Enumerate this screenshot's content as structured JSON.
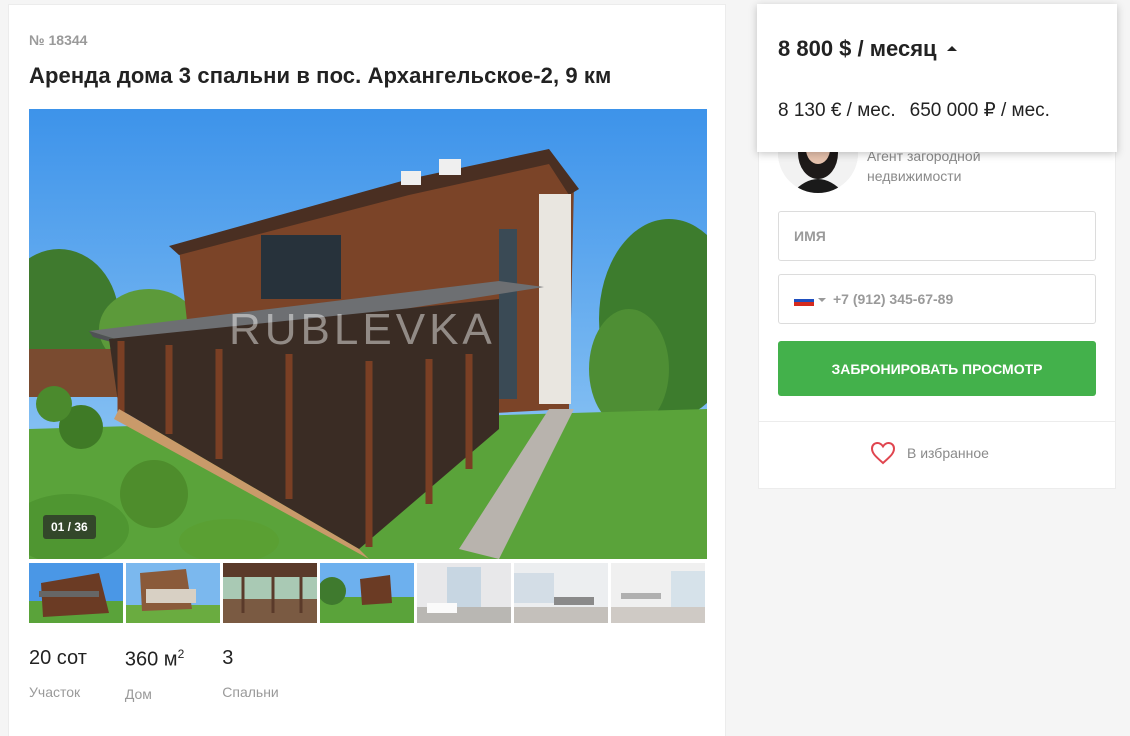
{
  "listing": {
    "number": "№ 18344",
    "title": "Аренда дома 3 спальни в пос. Архангельское-2, 9 км",
    "photo_counter": "01 / 36",
    "watermark": "RUBLEVKA"
  },
  "stats": [
    {
      "value": "20 сот",
      "label": "Участок"
    },
    {
      "value": "360 м",
      "sup": "2",
      "label": "Дом"
    },
    {
      "value": "3",
      "label": "Спальни"
    }
  ],
  "price": {
    "main": "8 800 $ / месяц",
    "eur": "8 130 € / мес.",
    "rub": "650 000 ₽ / мес."
  },
  "agent": {
    "role": "Агент загородной недвижимости"
  },
  "form": {
    "name_placeholder": "ИМЯ",
    "phone_placeholder": "+7 (912) 345-67-89",
    "book_label": "ЗАБРОНИРОВАТЬ ПРОСМОТР"
  },
  "favorite": {
    "label": "В избранное"
  },
  "colors": {
    "accent": "#43b14b",
    "heart": "#e0454f",
    "muted": "#9a9a9a"
  }
}
